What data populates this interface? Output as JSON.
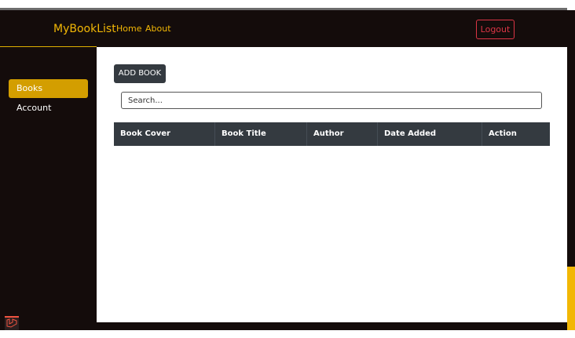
{
  "navbar": {
    "brand": "MyBookList",
    "links": [
      "Home",
      "About"
    ],
    "logout_label": "Logout"
  },
  "sidebar": {
    "items": [
      {
        "label": "Books",
        "active": true
      },
      {
        "label": "Account",
        "active": false
      }
    ]
  },
  "main": {
    "add_button_label": "ADD BOOK",
    "search_placeholder": "Search...",
    "table": {
      "headers": [
        "Book Cover",
        "Book Title",
        "Author",
        "Date Added",
        "Action"
      ],
      "rows": []
    }
  },
  "colors": {
    "dark_bg": "#140c0b",
    "accent": "#f2b705",
    "active_item": "#d39e00",
    "danger": "#dc3545",
    "table_head": "#343a40"
  },
  "icons": {
    "corner": "laravel-icon"
  }
}
